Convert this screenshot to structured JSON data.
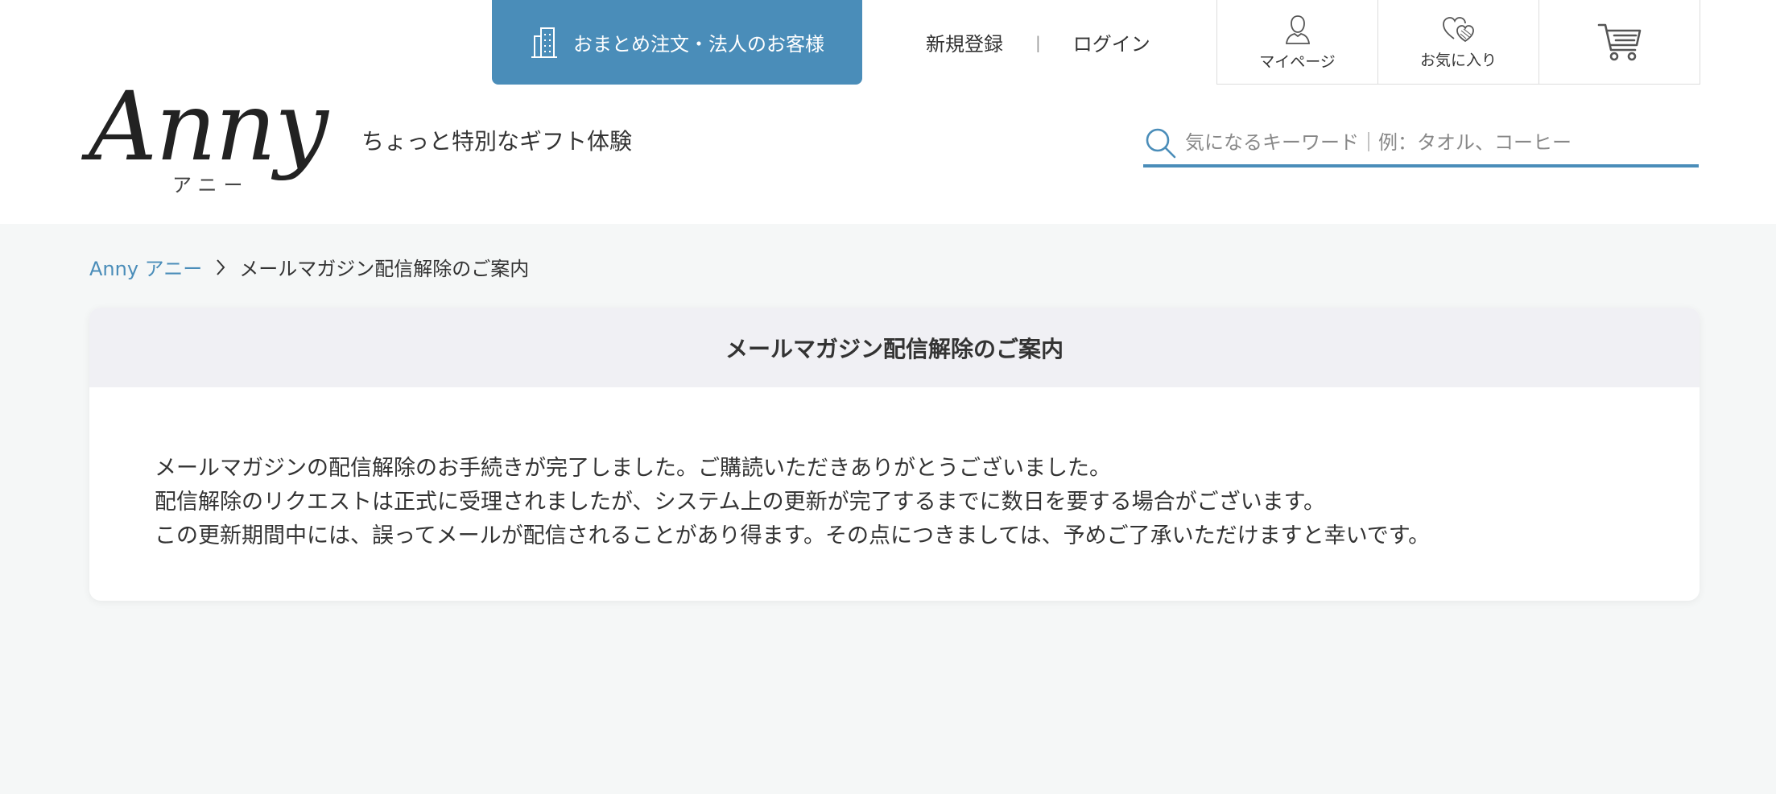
{
  "header": {
    "corporate_button": "おまとめ注文・法人のお客様",
    "register_link": "新規登録",
    "separator": "|",
    "login_link": "ログイン",
    "mypage_label": "マイページ",
    "favorites_label": "お気に入り",
    "logo_text": "Anny",
    "logo_kana": "アニー",
    "tagline": "ちょっと特別なギフト体験",
    "search_placeholder": "気になるキーワード｜例：タオル、コーヒー"
  },
  "breadcrumb": {
    "home": "Anny アニー",
    "current": "メールマガジン配信解除のご案内"
  },
  "card": {
    "title": "メールマガジン配信解除のご案内",
    "lines": [
      "メールマガジンの配信解除のお手続きが完了しました。ご購読いただきありがとうございました。",
      "配信解除のリクエストは正式に受理されましたが、システム上の更新が完了するまでに数日を要する場合がございます。",
      "この更新期間中には、誤ってメールが配信されることがあり得ます。その点につきましては、予めご了承いただけますと幸いです。"
    ]
  },
  "colors": {
    "accent": "#4a8db9",
    "card_header_bg": "#f0f0f4",
    "page_bg": "#f5f7f7"
  },
  "icons": {
    "corporate": "building-icon",
    "mypage": "user-icon",
    "favorites": "heart-icon",
    "cart": "cart-icon",
    "search": "search-icon",
    "breadcrumb_separator": "chevron-right-icon"
  }
}
